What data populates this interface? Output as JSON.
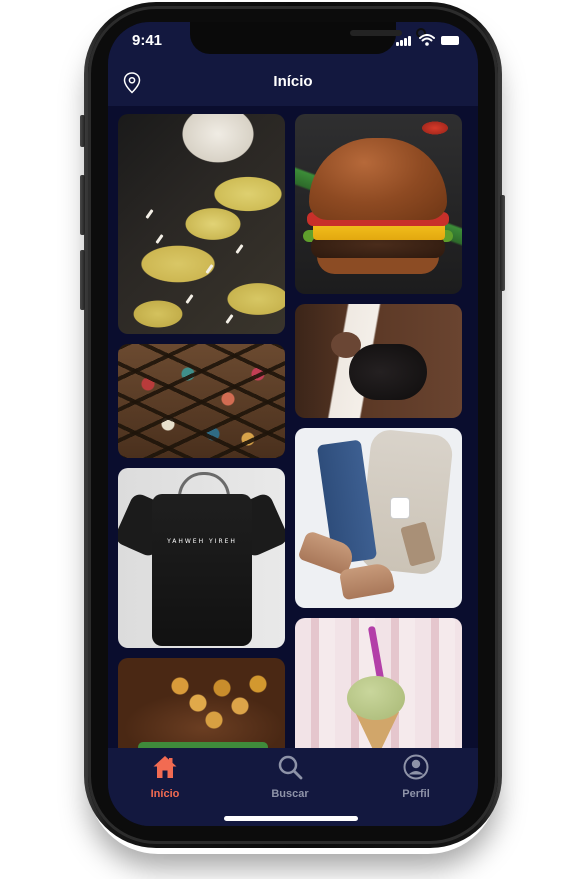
{
  "status_bar": {
    "time": "9:41"
  },
  "header": {
    "title": "Início",
    "left_icon": "location-pin-icon"
  },
  "feed": {
    "items": [
      {
        "image": "ravioli-pasta-photo"
      },
      {
        "image": "cheeseburger-photo"
      },
      {
        "image": "woman-lying-down-photo"
      },
      {
        "image": "jewelry-bead-box-photo"
      },
      {
        "image": "clothes-flatlay-photo"
      },
      {
        "image": "black-tshirt-on-hanger-photo",
        "print_text": "YAHWEH YIREH"
      },
      {
        "image": "ice-cream-cone-photo"
      },
      {
        "image": "grilled-chicken-photo"
      }
    ]
  },
  "tab_bar": {
    "tabs": [
      {
        "label": "Início",
        "icon": "home-icon",
        "active": true
      },
      {
        "label": "Buscar",
        "icon": "search-icon",
        "active": false
      },
      {
        "label": "Perfil",
        "icon": "profile-icon",
        "active": false
      }
    ]
  },
  "colors": {
    "background": "#0a0d2e",
    "bar": "#13183f",
    "accent": "#f26b52",
    "inactive": "#8e93a8",
    "text": "#ffffff"
  }
}
